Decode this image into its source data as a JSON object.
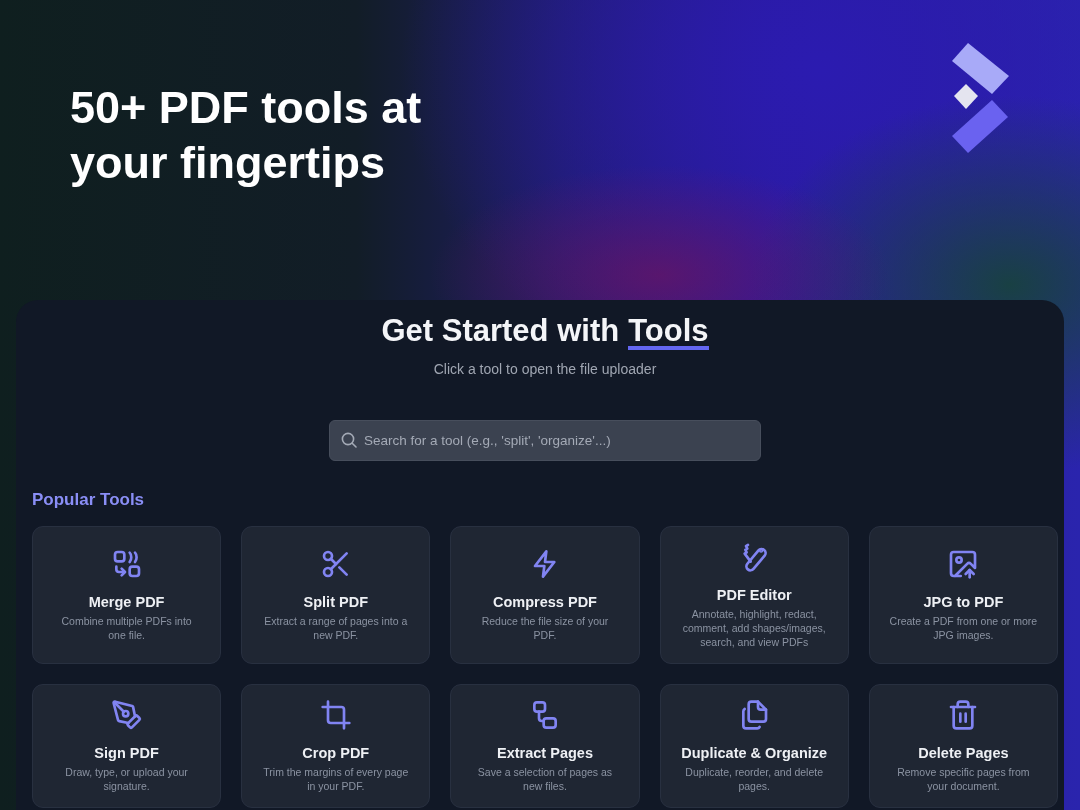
{
  "hero": {
    "heading": "50+ PDF tools at your fingertips"
  },
  "panel": {
    "title": "Get Started with",
    "title_highlight": "Tools",
    "subtitle": "Click a tool to open the file uploader",
    "search": {
      "placeholder": "Search for a tool (e.g., 'split', 'organize'...)"
    },
    "section_title": "Popular Tools",
    "tools": [
      {
        "title": "Merge PDF",
        "description": "Combine multiple PDFs into one file."
      },
      {
        "title": "Split PDF",
        "description": "Extract a range of pages into a new PDF."
      },
      {
        "title": "Compress PDF",
        "description": "Reduce the file size of your PDF."
      },
      {
        "title": "PDF Editor",
        "description": "Annotate, highlight, redact, comment, add shapes/images, search, and view PDFs"
      },
      {
        "title": "JPG to PDF",
        "description": "Create a PDF from one or more JPG images."
      },
      {
        "title": "Sign PDF",
        "description": "Draw, type, or upload your signature."
      },
      {
        "title": "Crop PDF",
        "description": "Trim the margins of every page in your PDF."
      },
      {
        "title": "Extract Pages",
        "description": "Save a selection of pages as new files."
      },
      {
        "title": "Duplicate & Organize",
        "description": "Duplicate, reorder, and delete pages."
      },
      {
        "title": "Delete Pages",
        "description": "Remove specific pages from your document."
      }
    ]
  }
}
